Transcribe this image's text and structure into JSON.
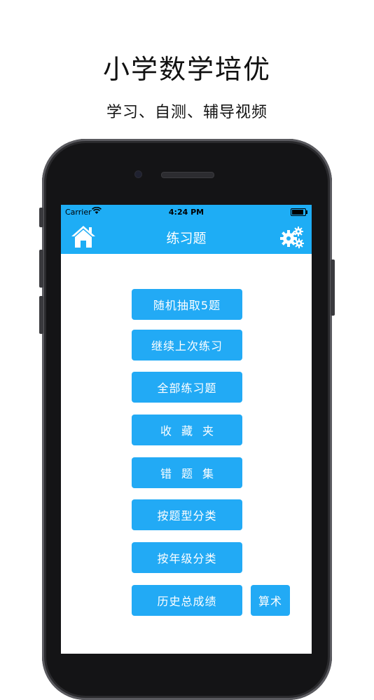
{
  "promo": {
    "title": "小学数学培优",
    "subtitle": "学习、自测、辅导视频"
  },
  "status_bar": {
    "carrier": "Carrier",
    "time": "4:24 PM"
  },
  "nav": {
    "title": "练习题",
    "left_icon": "home-icon",
    "right_icon": "settings-icon"
  },
  "menu": {
    "random5": "随机抽取5题",
    "continue_last": "继续上次练习",
    "all_questions": "全部练习题",
    "favorites": "收藏夹",
    "wrong_questions": "错题集",
    "by_type": "按题型分类",
    "by_grade": "按年级分类",
    "history_scores": "历史总成绩",
    "arithmetic": "算术"
  },
  "colors": {
    "accent": "#1eadf5",
    "button": "#22aaf5"
  }
}
